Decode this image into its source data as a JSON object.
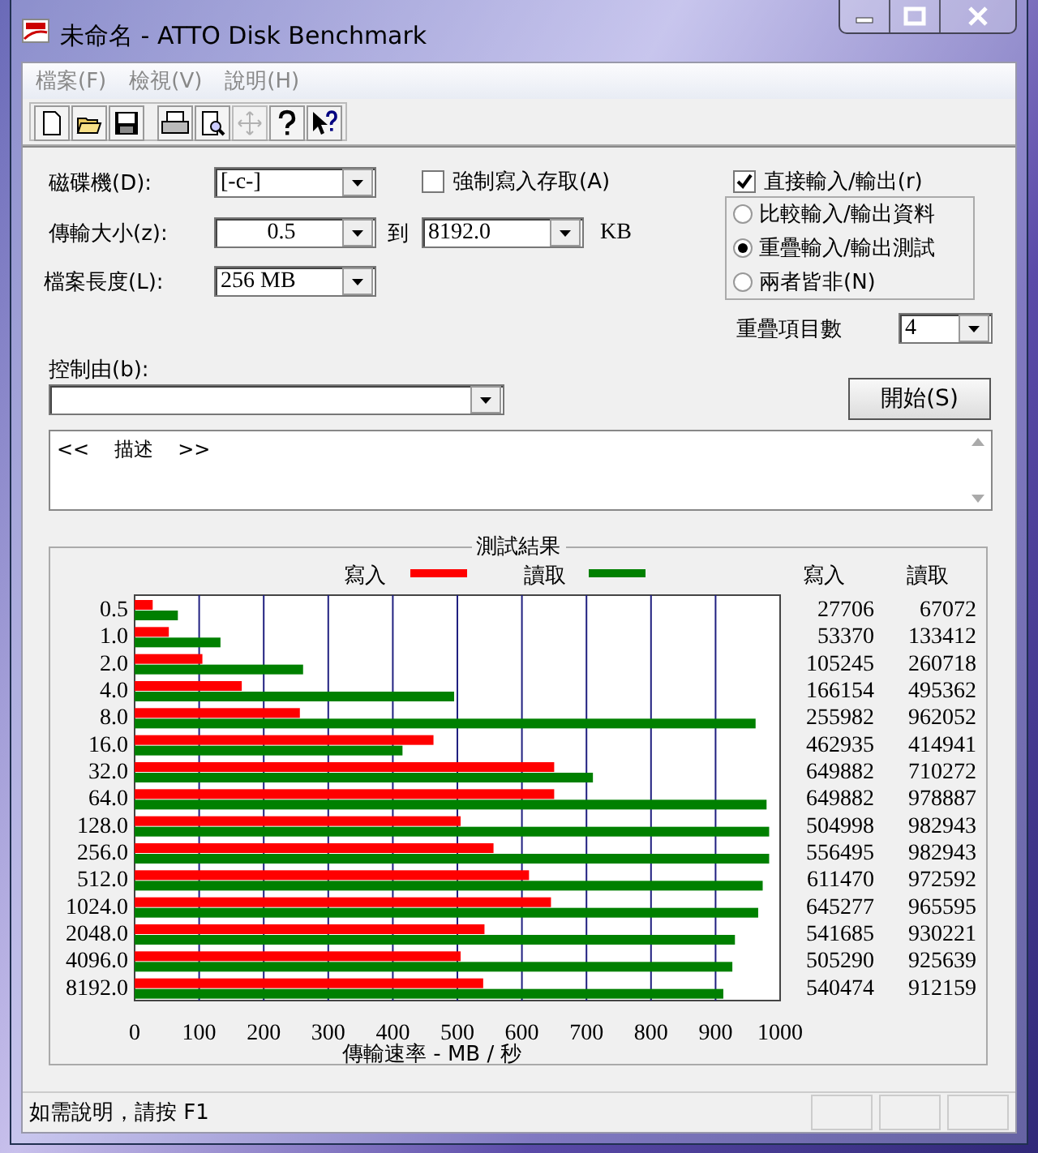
{
  "window": {
    "title": "未命名 - ATTO Disk Benchmark"
  },
  "menu": [
    {
      "label": "檔案(F)"
    },
    {
      "label": "檢視(V)"
    },
    {
      "label": "說明(H)"
    }
  ],
  "toolbar": [
    {
      "kind": "new",
      "disabled": false
    },
    {
      "kind": "open",
      "disabled": false
    },
    {
      "kind": "save",
      "disabled": false
    },
    {
      "kind": "print",
      "disabled": false
    },
    {
      "kind": "preview",
      "disabled": false
    },
    {
      "kind": "move",
      "disabled": true
    },
    {
      "kind": "help",
      "disabled": false
    },
    {
      "kind": "context-help",
      "disabled": false
    }
  ],
  "form": {
    "drive": {
      "label": "磁碟機(D):",
      "value": "[-c-]"
    },
    "force_write": {
      "label": "強制寫入存取(A)",
      "checked": false
    },
    "transfer_size": {
      "label": "傳輸大小(z):",
      "from": "0.5",
      "to_label": "到",
      "to": "8192.0",
      "unit": "KB"
    },
    "file_length": {
      "label": "檔案長度(L):",
      "value": "256 MB"
    },
    "direct_io": {
      "label": "直接輸入/輸出(r)",
      "checked": true
    },
    "io_mode": [
      {
        "label": "比較輸入/輸出資料",
        "selected": false
      },
      {
        "label": "重疊輸入/輸出測試",
        "selected": true
      },
      {
        "label": "兩者皆非(N)",
        "selected": false
      }
    ],
    "queue_depth": {
      "label": "重疊項目數",
      "value": "4"
    },
    "controlled_by": {
      "label": "控制由(b):"
    },
    "start_button": "開始(S)",
    "description": "<<    描述    >>"
  },
  "results": {
    "title": "測試結果",
    "chart_data": {
      "type": "bar",
      "orientation": "horizontal",
      "xlabel": "傳輸速率 - MB / 秒",
      "categories": [
        "0.5",
        "1.0",
        "2.0",
        "4.0",
        "8.0",
        "16.0",
        "32.0",
        "64.0",
        "128.0",
        "256.0",
        "512.0",
        "1024.0",
        "2048.0",
        "4096.0",
        "8192.0"
      ],
      "series": [
        {
          "name": "寫入",
          "color": "#ff0000",
          "values": [
            28,
            53,
            105,
            166,
            256,
            463,
            650,
            650,
            505,
            556,
            611,
            645,
            542,
            505,
            540
          ]
        },
        {
          "name": "讀取",
          "color": "#008000",
          "values": [
            67,
            133,
            261,
            495,
            962,
            415,
            710,
            979,
            983,
            983,
            973,
            966,
            930,
            926,
            912
          ]
        }
      ],
      "grid": true,
      "legend": true,
      "xlim": [
        0,
        1000
      ],
      "xticks": [
        0,
        100,
        200,
        300,
        400,
        500,
        600,
        700,
        800,
        900,
        1000
      ]
    },
    "table": {
      "columns": [
        "寫入",
        "讀取"
      ],
      "rows": [
        [
          "27706",
          "67072"
        ],
        [
          "53370",
          "133412"
        ],
        [
          "105245",
          "260718"
        ],
        [
          "166154",
          "495362"
        ],
        [
          "255982",
          "962052"
        ],
        [
          "462935",
          "414941"
        ],
        [
          "649882",
          "710272"
        ],
        [
          "649882",
          "978887"
        ],
        [
          "504998",
          "982943"
        ],
        [
          "556495",
          "982943"
        ],
        [
          "611470",
          "972592"
        ],
        [
          "645277",
          "965595"
        ],
        [
          "541685",
          "930221"
        ],
        [
          "505290",
          "925639"
        ],
        [
          "540474",
          "912159"
        ]
      ]
    }
  },
  "status_bar": {
    "text": "如需說明，請按 F1"
  }
}
